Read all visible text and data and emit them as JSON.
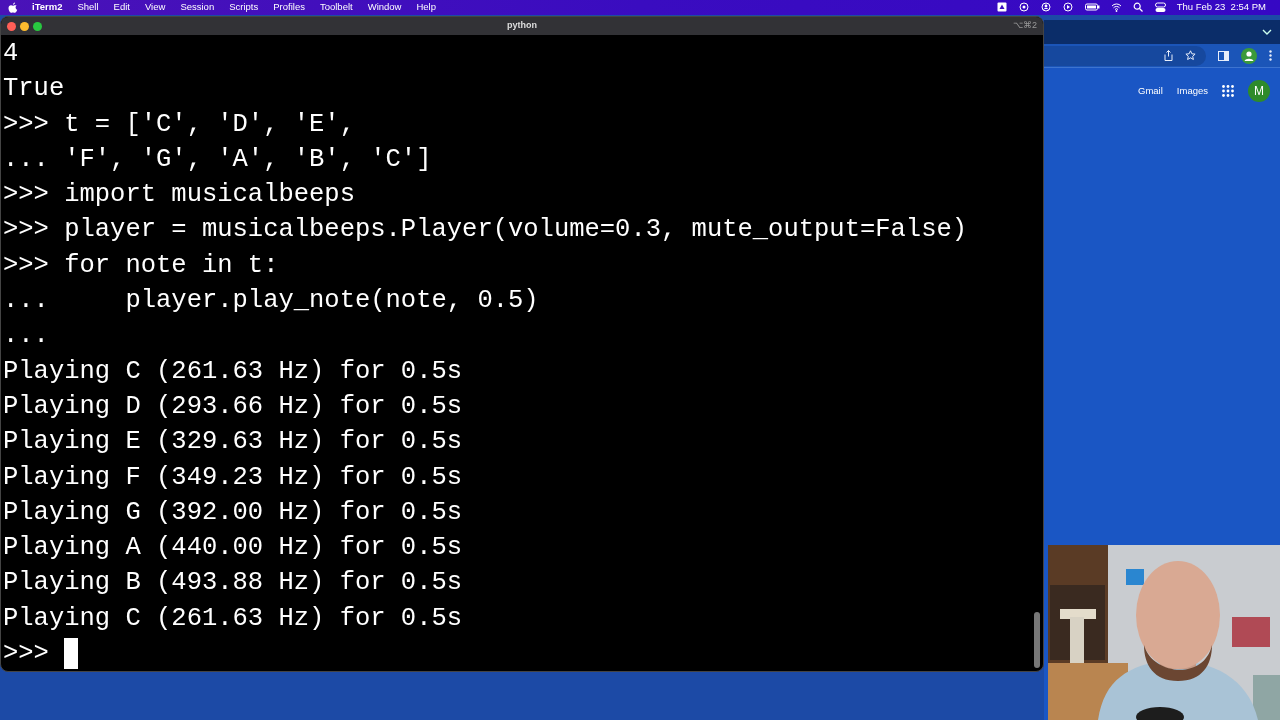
{
  "menu_bar": {
    "app": "iTerm2",
    "menus": [
      "Shell",
      "Edit",
      "View",
      "Session",
      "Scripts",
      "Profiles",
      "Toolbelt",
      "Window",
      "Help"
    ],
    "clock": "Thu Feb 23  2:54 PM"
  },
  "terminal": {
    "title": "python",
    "shortcut": "⌥⌘2",
    "lines": [
      {
        "text": "4",
        "cursor": false
      },
      {
        "text": "True",
        "cursor": false
      },
      {
        "text": ">>> t = ['C', 'D', 'E',",
        "cursor": false
      },
      {
        "text": "... 'F', 'G', 'A', 'B', 'C']",
        "cursor": false
      },
      {
        "text": ">>> import musicalbeeps",
        "cursor": false
      },
      {
        "text": ">>> player = musicalbeeps.Player(volume=0.3, mute_output=False)",
        "cursor": false
      },
      {
        "text": ">>> for note in t:",
        "cursor": false
      },
      {
        "text": "...     player.play_note(note, 0.5)",
        "cursor": false
      },
      {
        "text": "...",
        "cursor": false
      },
      {
        "text": "Playing C (261.63 Hz) for 0.5s",
        "cursor": false
      },
      {
        "text": "Playing D (293.66 Hz) for 0.5s",
        "cursor": false
      },
      {
        "text": "Playing E (329.63 Hz) for 0.5s",
        "cursor": false
      },
      {
        "text": "Playing F (349.23 Hz) for 0.5s",
        "cursor": false
      },
      {
        "text": "Playing G (392.00 Hz) for 0.5s",
        "cursor": false
      },
      {
        "text": "Playing A (440.00 Hz) for 0.5s",
        "cursor": false
      },
      {
        "text": "Playing B (493.88 Hz) for 0.5s",
        "cursor": false
      },
      {
        "text": "Playing C (261.63 Hz) for 0.5s",
        "cursor": false
      },
      {
        "text": ">>> ",
        "cursor": true
      }
    ]
  },
  "browser": {
    "links": [
      "Gmail",
      "Images"
    ],
    "avatar": "M"
  }
}
